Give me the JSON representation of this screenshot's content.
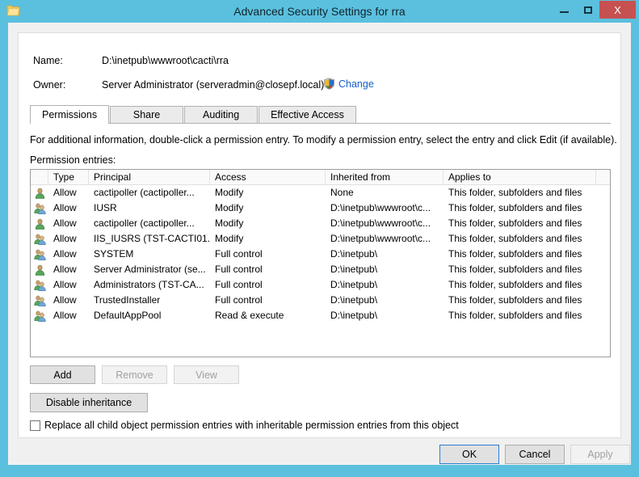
{
  "window": {
    "title": "Advanced Security Settings for rra",
    "icon": "folder-icon",
    "controls": {
      "minimize": "–",
      "maximize": "□",
      "close": "X"
    }
  },
  "header": {
    "name_label": "Name:",
    "name_value": "D:\\inetpub\\wwwroot\\cacti\\rra",
    "owner_label": "Owner:",
    "owner_value": "Server Administrator (serveradmin@closepf.local)",
    "change_link": "Change",
    "change_icon": "uac-shield-icon"
  },
  "tabs": [
    {
      "label": "Permissions",
      "active": true
    },
    {
      "label": "Share",
      "active": false
    },
    {
      "label": "Auditing",
      "active": false
    },
    {
      "label": "Effective Access",
      "active": false
    }
  ],
  "main": {
    "info_text": "For additional information, double-click a permission entry. To modify a permission entry, select the entry and click Edit (if available).",
    "entries_label": "Permission entries:"
  },
  "grid": {
    "columns": [
      "",
      "Type",
      "Principal",
      "Access",
      "Inherited from",
      "Applies to",
      ""
    ],
    "rows": [
      {
        "icon": "user-icon",
        "type": "Allow",
        "principal": "cactipoller (cactipoller...",
        "access": "Modify",
        "inherited_from": "None",
        "applies_to": "This folder, subfolders and files"
      },
      {
        "icon": "group-icon",
        "type": "Allow",
        "principal": "IUSR",
        "access": "Modify",
        "inherited_from": "D:\\inetpub\\wwwroot\\c...",
        "applies_to": "This folder, subfolders and files"
      },
      {
        "icon": "user-icon",
        "type": "Allow",
        "principal": "cactipoller (cactipoller...",
        "access": "Modify",
        "inherited_from": "D:\\inetpub\\wwwroot\\c...",
        "applies_to": "This folder, subfolders and files"
      },
      {
        "icon": "group-icon",
        "type": "Allow",
        "principal": "IIS_IUSRS (TST-CACTI01...",
        "access": "Modify",
        "inherited_from": "D:\\inetpub\\wwwroot\\c...",
        "applies_to": "This folder, subfolders and files"
      },
      {
        "icon": "group-icon",
        "type": "Allow",
        "principal": "SYSTEM",
        "access": "Full control",
        "inherited_from": "D:\\inetpub\\",
        "applies_to": "This folder, subfolders and files"
      },
      {
        "icon": "user-icon",
        "type": "Allow",
        "principal": "Server Administrator (se...",
        "access": "Full control",
        "inherited_from": "D:\\inetpub\\",
        "applies_to": "This folder, subfolders and files"
      },
      {
        "icon": "group-icon",
        "type": "Allow",
        "principal": "Administrators (TST-CA...",
        "access": "Full control",
        "inherited_from": "D:\\inetpub\\",
        "applies_to": "This folder, subfolders and files"
      },
      {
        "icon": "group-icon",
        "type": "Allow",
        "principal": "TrustedInstaller",
        "access": "Full control",
        "inherited_from": "D:\\inetpub\\",
        "applies_to": "This folder, subfolders and files"
      },
      {
        "icon": "group-icon",
        "type": "Allow",
        "principal": "DefaultAppPool",
        "access": "Read & execute",
        "inherited_from": "D:\\inetpub\\",
        "applies_to": "This folder, subfolders and files"
      }
    ]
  },
  "actions": {
    "add": "Add",
    "remove": "Remove",
    "view": "View",
    "disable_inheritance": "Disable inheritance",
    "add_enabled": true,
    "remove_enabled": false,
    "view_enabled": false
  },
  "replace_option": {
    "label": "Replace all child object permission entries with inheritable permission entries from this object",
    "checked": false
  },
  "footer": {
    "ok": "OK",
    "cancel": "Cancel",
    "apply": "Apply",
    "apply_enabled": false
  },
  "colors": {
    "titlebar": "#5bc0de",
    "close_button": "#c75050",
    "link": "#1660c9",
    "dialog_background": "#f0f0f0",
    "panel_background": "#ffffff"
  }
}
